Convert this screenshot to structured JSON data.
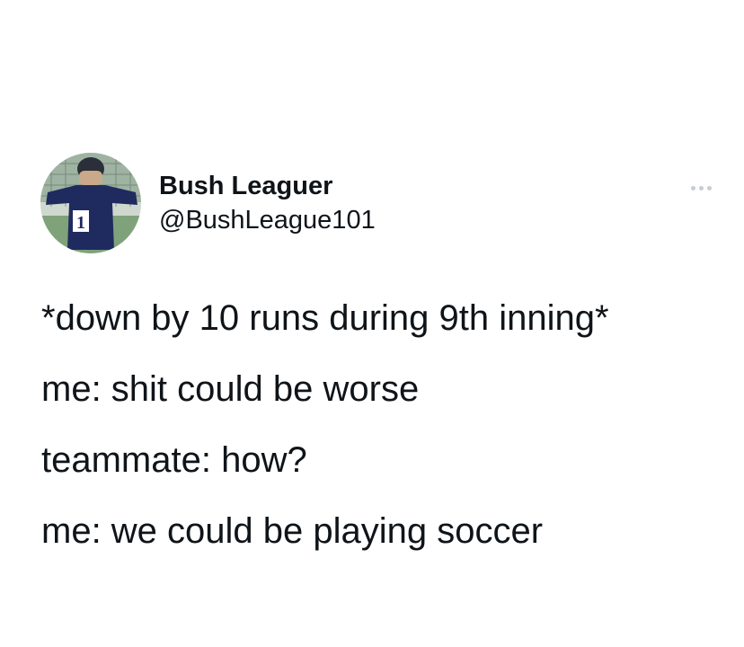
{
  "author": {
    "display_name": "Bush Leaguer",
    "handle": "@BushLeague101",
    "avatar_jersey_number": "1"
  },
  "more_icon": "more-horizontal-icon",
  "tweet": {
    "lines": [
      "*down by 10 runs during 9th inning*",
      "me: shit could be worse",
      "teammate: how?",
      "me: we could be playing soccer"
    ]
  },
  "colors": {
    "text": "#0f1419",
    "background": "#ffffff",
    "more_dots": "#c7ccd1",
    "jersey": "#1f2b5e"
  }
}
